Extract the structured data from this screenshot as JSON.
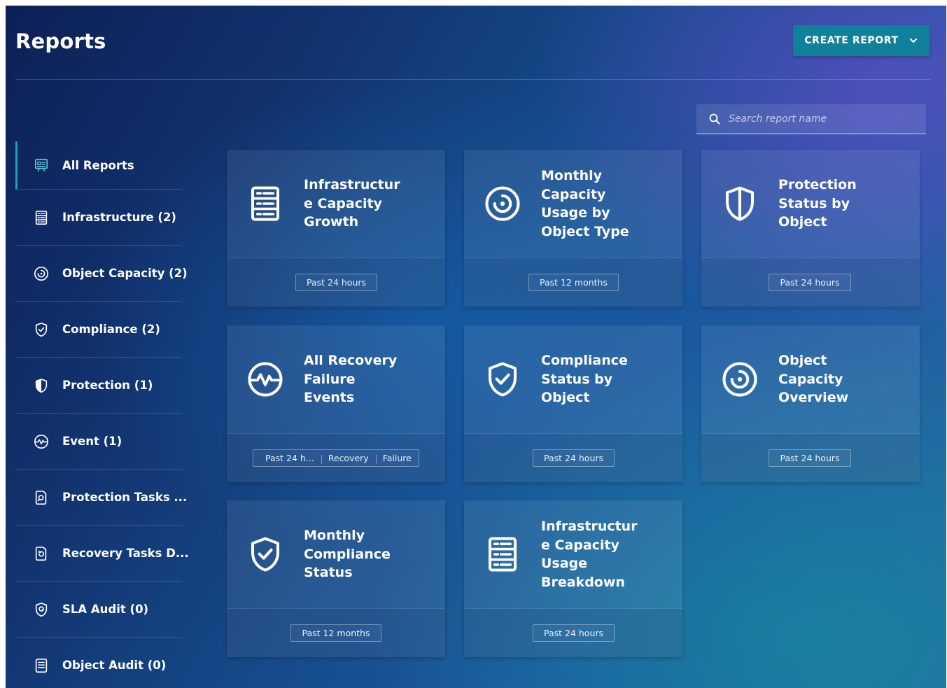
{
  "header": {
    "title": "Reports",
    "create_button_label": "CREATE REPORT",
    "create_button_icon": "chevron-down-icon"
  },
  "search": {
    "placeholder": "Search report name",
    "value": ""
  },
  "colors": {
    "accent": "#11809a",
    "active_indicator": "#1aa3b8"
  },
  "sidebar": {
    "items": [
      {
        "label": "All Reports",
        "icon": "dashboard-icon",
        "active": true
      },
      {
        "label": "Infrastructure (2)",
        "icon": "server-icon"
      },
      {
        "label": "Object Capacity (2)",
        "icon": "target-icon"
      },
      {
        "label": "Compliance (2)",
        "icon": "shield-check-icon"
      },
      {
        "label": "Protection (1)",
        "icon": "half-shield-icon"
      },
      {
        "label": "Event (1)",
        "icon": "pulse-icon"
      },
      {
        "label": "Protection Tasks ...",
        "icon": "search-document-icon"
      },
      {
        "label": "Recovery Tasks D...",
        "icon": "restore-document-icon"
      },
      {
        "label": "SLA Audit (0)",
        "icon": "shield-lock-icon"
      },
      {
        "label": "Object Audit (0)",
        "icon": "list-document-icon"
      }
    ]
  },
  "cards": [
    {
      "title": "Infrastructure Capacity Growth",
      "icon": "server-icon",
      "tags": [
        "Past 24 hours"
      ]
    },
    {
      "title": "Monthly Capacity Usage by Object Type",
      "icon": "target-icon",
      "tags": [
        "Past 12 months"
      ]
    },
    {
      "title": "Protection Status by Object",
      "icon": "half-shield-icon",
      "tags": [
        "Past 24 hours"
      ]
    },
    {
      "title": "All Recovery Failure Events",
      "icon": "pulse-icon",
      "tags": [
        "Past 24 h...",
        "Recovery",
        "Failure"
      ]
    },
    {
      "title": "Compliance Status by Object",
      "icon": "shield-check-icon",
      "tags": [
        "Past 24 hours"
      ]
    },
    {
      "title": "Object Capacity Overview",
      "icon": "target-icon",
      "tags": [
        "Past 24 hours"
      ]
    },
    {
      "title": "Monthly Compliance Status",
      "icon": "shield-check-icon",
      "tags": [
        "Past 12 months"
      ]
    },
    {
      "title": "Infrastructure Capacity Usage Breakdown",
      "icon": "server-icon",
      "tags": [
        "Past 24 hours"
      ]
    }
  ]
}
